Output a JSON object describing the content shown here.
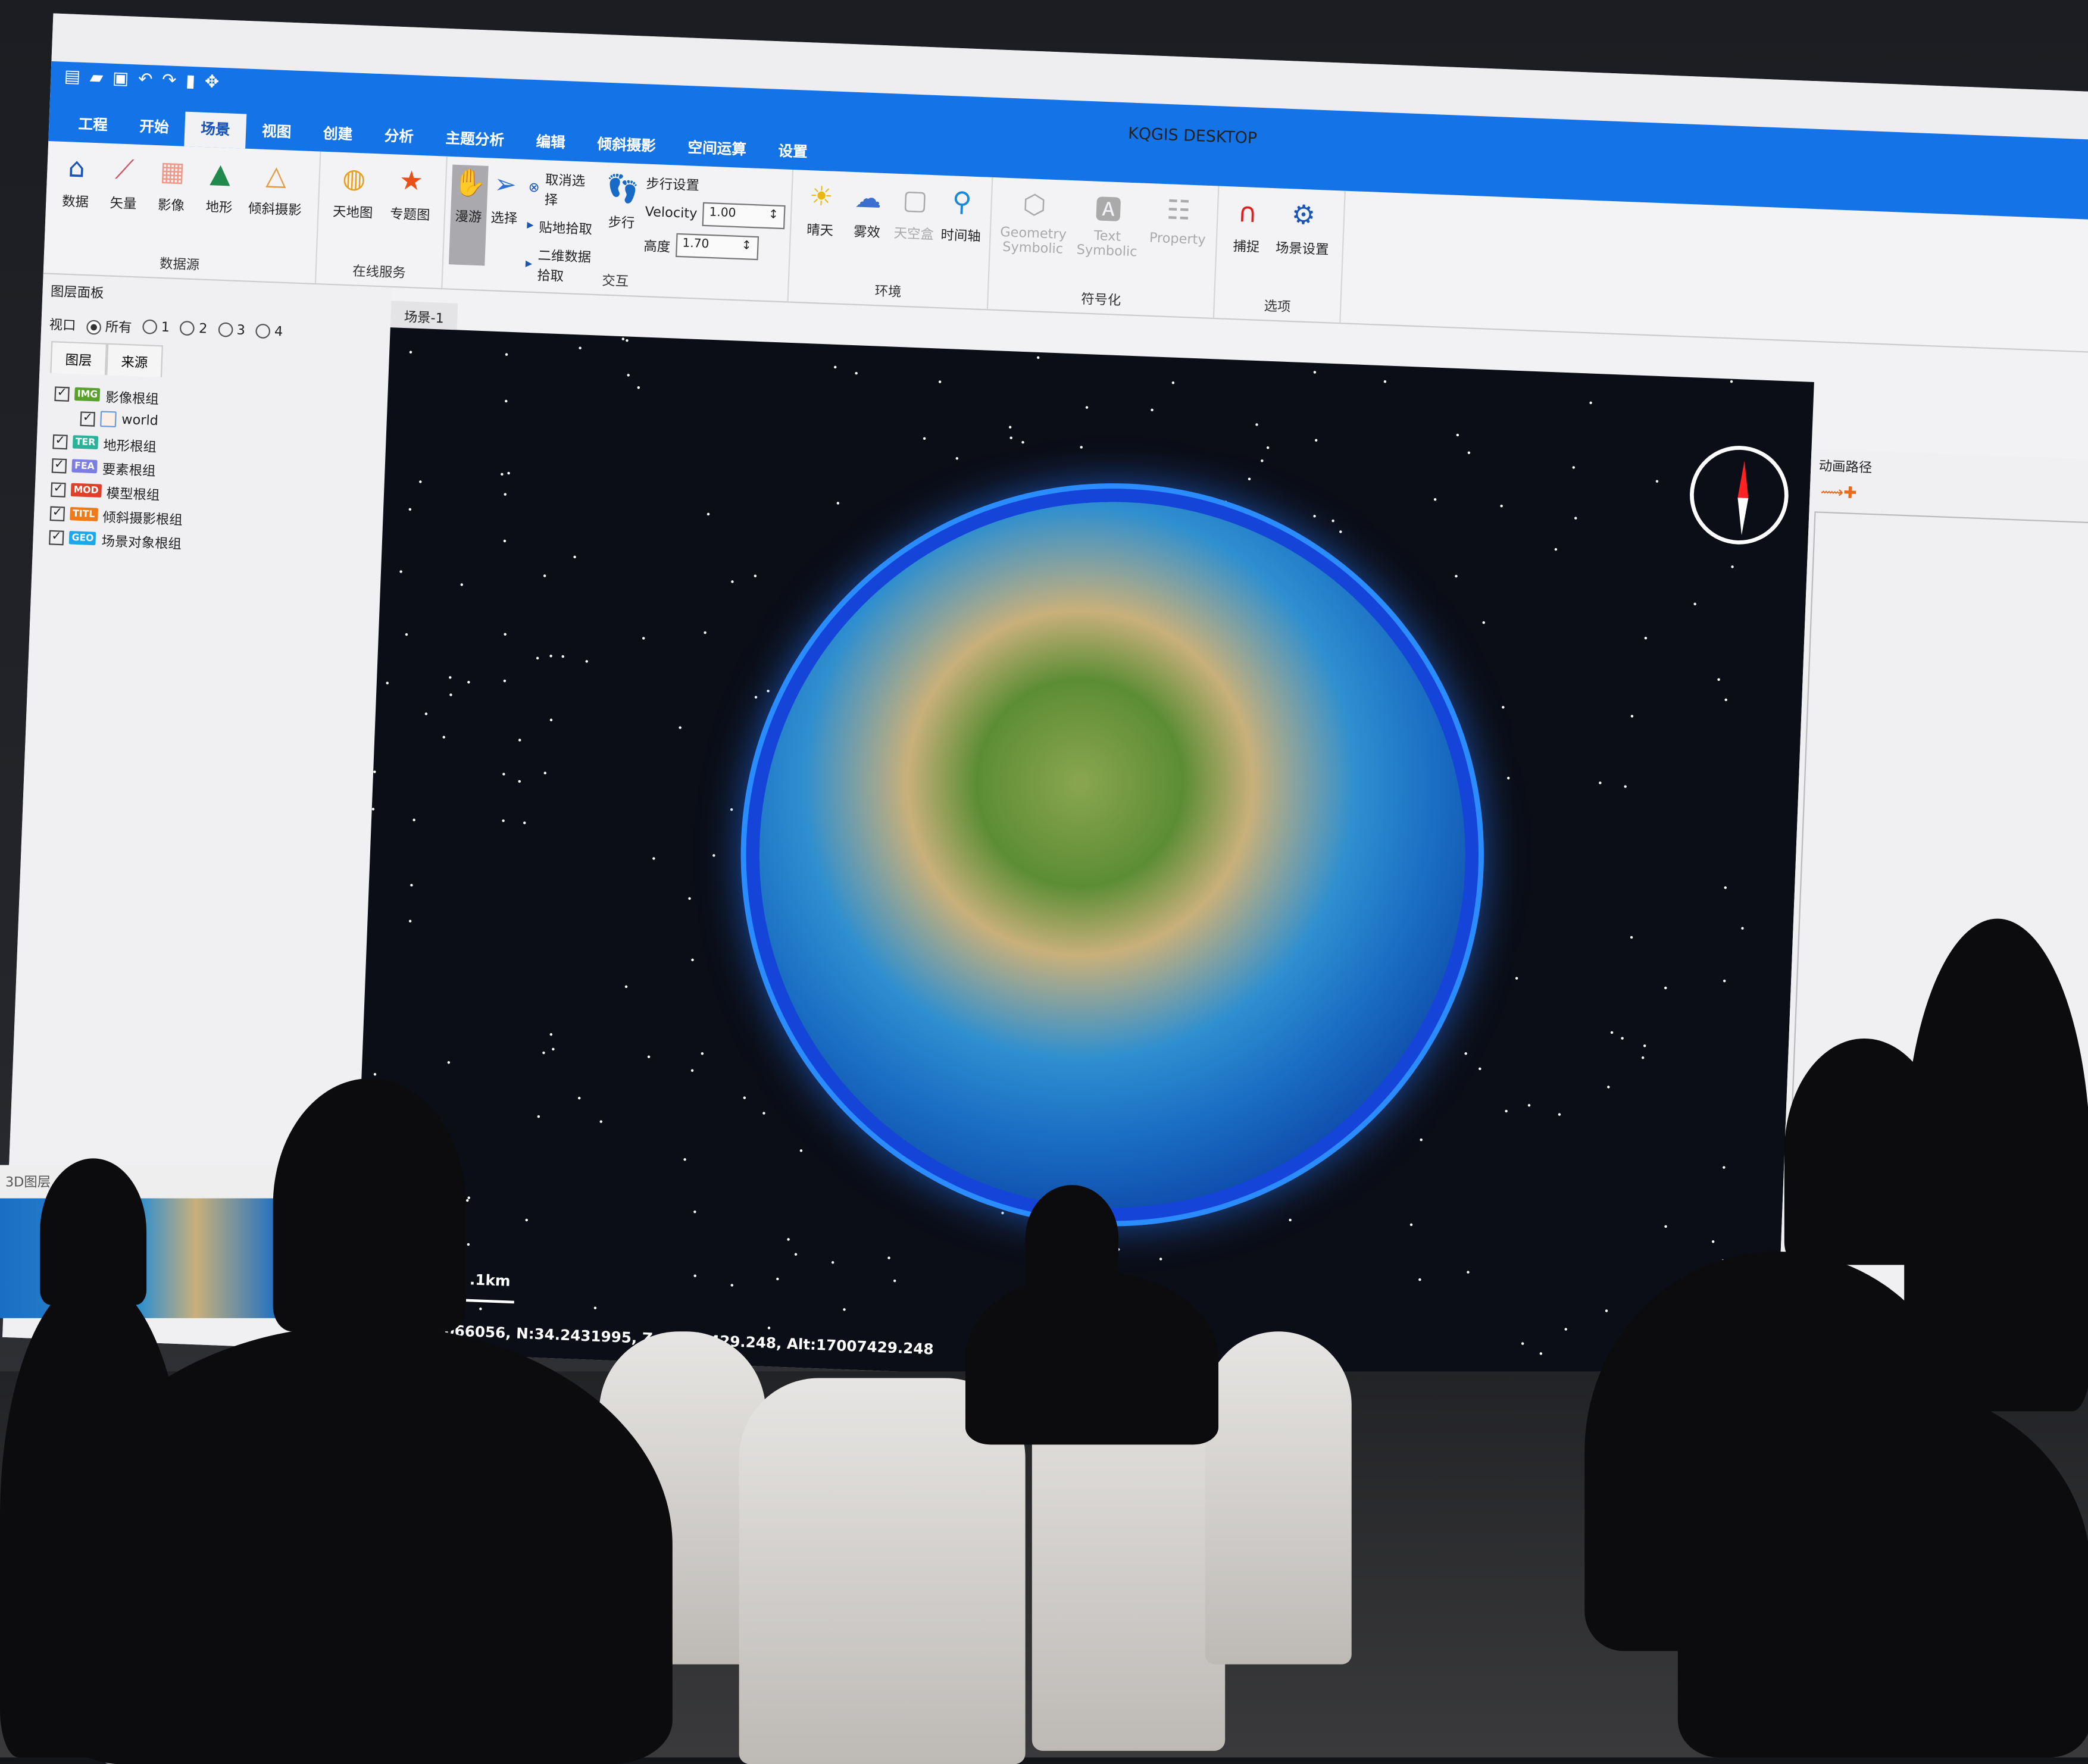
{
  "app": {
    "title": "KQGIS DESKTOP"
  },
  "quick_access": [
    "new-icon",
    "open-icon",
    "save-icon",
    "undo-icon",
    "redo-icon",
    "select-icon",
    "move-icon"
  ],
  "tabs": [
    "工程",
    "开始",
    "场景",
    "视图",
    "创建",
    "分析",
    "主题分析",
    "编辑",
    "倾斜摄影",
    "空间运算",
    "设置"
  ],
  "active_tab": "场景",
  "ribbon": {
    "datasource": {
      "label": "数据源",
      "buttons": [
        "数据",
        "矢量",
        "影像",
        "地形",
        "倾斜摄影"
      ]
    },
    "online": {
      "label": "在线服务",
      "buttons": [
        "天地图",
        "专题图"
      ]
    },
    "interact": {
      "label": "交互",
      "roam": "漫游",
      "select": "选择",
      "cancel_select": "取消选择",
      "ground_pick": "贴地拾取",
      "pick_2d": "二维数据拾取"
    },
    "walk": {
      "walk": "步行",
      "settings": "步行设置",
      "velocity_label": "Velocity",
      "velocity": "1.00",
      "height_label": "高度",
      "height": "1.70"
    },
    "env": {
      "label": "环境",
      "buttons": [
        "晴天",
        "雾效",
        "天空盒",
        "时间轴"
      ]
    },
    "symbol": {
      "label": "符号化",
      "buttons": [
        "Geometry Symbolic",
        "Text Symbolic",
        "Property"
      ]
    },
    "options": {
      "label": "选项",
      "buttons": [
        "捕捉",
        "场景设置"
      ]
    }
  },
  "layer_panel": {
    "title": "图层面板",
    "viewport_label": "视口",
    "viewports": [
      "所有",
      "1",
      "2",
      "3",
      "4"
    ],
    "selected_viewport": "所有",
    "tabs": [
      "图层",
      "来源"
    ],
    "layers": [
      {
        "badge": "IMG",
        "label": "影像根组",
        "color": "#5aa02c",
        "checked": true
      },
      {
        "badge": "",
        "label": "world",
        "child": true,
        "checked": true
      },
      {
        "badge": "TER",
        "label": "地形根组",
        "color": "#2bb39a",
        "checked": true
      },
      {
        "badge": "FEA",
        "label": "要素根组",
        "color": "#7b7ee0",
        "checked": true
      },
      {
        "badge": "MOD",
        "label": "模型根组",
        "color": "#e0402a",
        "checked": true
      },
      {
        "badge": "TITL",
        "label": "倾斜摄影根组",
        "color": "#ee7a1a",
        "checked": true
      },
      {
        "badge": "GEO",
        "label": "场景对象根组",
        "color": "#1aa8e8",
        "checked": true
      }
    ]
  },
  "scene": {
    "tab": "场景-1",
    "scale": ".1km",
    "coords": "2.7066056, N:34.2431995, Z:17007429.248, Alt:17007429.248"
  },
  "right_panel": {
    "title": "动画路径"
  },
  "bottom_left": {
    "label": "3D图层"
  }
}
